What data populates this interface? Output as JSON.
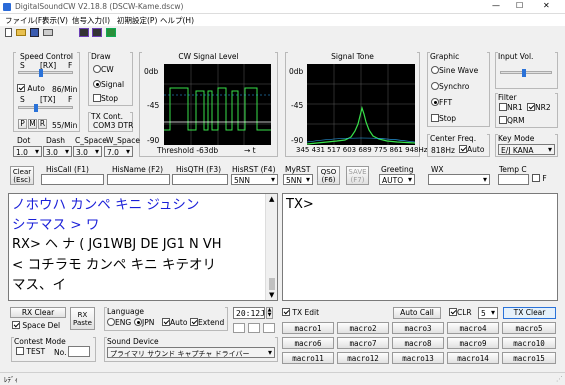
{
  "titlebar": {
    "title": "DigitalSoundCW V2.18.8   (DSCW-Kame.dscw)",
    "min": "—",
    "max": "☐",
    "close": "✕"
  },
  "menu": [
    "ファイル(F)",
    "表示(V)",
    "信号入力(I)",
    "初期設定(P)",
    "ヘルプ(H)"
  ],
  "speed": {
    "title": "Speed Control",
    "s": "S",
    "f": "F",
    "rx": "[RX]",
    "tx": "[TX]",
    "auto": "Auto",
    "rx_wpm": "86/Min",
    "tx_wpm": "55/Min",
    "p": "P",
    "m": "M",
    "r": "R",
    "auto_checked": true
  },
  "draw": {
    "title": "Draw",
    "options": [
      "CW",
      "Signal",
      "Stop"
    ],
    "selected": "Signal"
  },
  "txcont": {
    "title": "TX Cont.",
    "value": "COM3 DTR"
  },
  "cw_level": {
    "title": "CW Signal Level",
    "y0": "0db",
    "y1": "-45",
    "y2": "-90",
    "threshold": "Threshold -63db",
    "arrow": "→ t"
  },
  "tone": {
    "title": "Signal Tone",
    "y0": "0db",
    "y1": "-45",
    "y2": "-90",
    "xaxis": "345 431 517 603 689 775 861 948Hz"
  },
  "graphic": {
    "title": "Graphic",
    "options": [
      "Sine Wave",
      "Synchro",
      "FFT",
      "Stop"
    ],
    "selected": "FFT"
  },
  "input_vol": {
    "title": "Input Vol."
  },
  "filter": {
    "title": "Filter",
    "nr1": "NR1",
    "nr2": "NR2",
    "qrm": "QRM",
    "nr2_checked": true
  },
  "center_freq": {
    "title": "Center Freq.",
    "value": "818Hz",
    "auto": "Auto"
  },
  "key_mode": {
    "title": "Key Mode",
    "value": "E/J KANA"
  },
  "timing": {
    "dot": "Dot",
    "dash": "Dash",
    "c_space": "C_Space",
    "w_space": "W_Space",
    "dot_v": "1.0",
    "dash_v": "3.0",
    "c_v": "3.0",
    "w_v": "7.0"
  },
  "log": {
    "clear": "Clear\n(Esc)",
    "hiscall": "HisCall (F1)",
    "hisname": "HisName (F2)",
    "hisqth": "HisQTH (F3)",
    "hisrst": "HisRST (F4)",
    "hisrst_v": "5NN",
    "myrst": "MyRST",
    "myrst_v": "5NN",
    "qso": "QSO\n(F6)",
    "save": "SAVE\n(F7)",
    "greeting": "Greeting",
    "greeting_v": "AUTO",
    "wx": "WX",
    "temp": "Temp C",
    "f": "F"
  },
  "rx_text": {
    "line1": "ノホウハ カンペ キニ ジュシン",
    "line2": "シテマス > ワ",
    "line3": "RX> ヘ ナ  ( JG1WBJ DE JG1 N VH",
    "line4": "< コチラモ カンペ キニ キテオリ",
    "line5": "マス、イ"
  },
  "tx_text": {
    "line1": "TX>"
  },
  "bottom": {
    "rx_clear": "RX Clear",
    "space_del": "Space Del",
    "rx_paste": "RX\nPaste",
    "language": "Language",
    "eng": "ENG",
    "jpn": "JPN",
    "auto": "Auto",
    "extend": "Extend",
    "time": "20:12J",
    "tx_edit": "TX Edit",
    "auto_call": "Auto Call",
    "clr": "CLR",
    "clr_num": "5",
    "tx_clear": "TX Clear",
    "contest": "Contest Mode",
    "test": "TEST",
    "no": "No.",
    "sound_device": "Sound Device",
    "sound_v": "プライマリ サウンド キャプチャ ドライバー"
  },
  "macros": [
    "macro1",
    "macro2",
    "macro3",
    "macro4",
    "macro5",
    "macro6",
    "macro7",
    "macro8",
    "macro9",
    "macro10",
    "macro11",
    "macro12",
    "macro13",
    "macro14",
    "macro15"
  ],
  "status": "ﾚﾃﾞｨ"
}
